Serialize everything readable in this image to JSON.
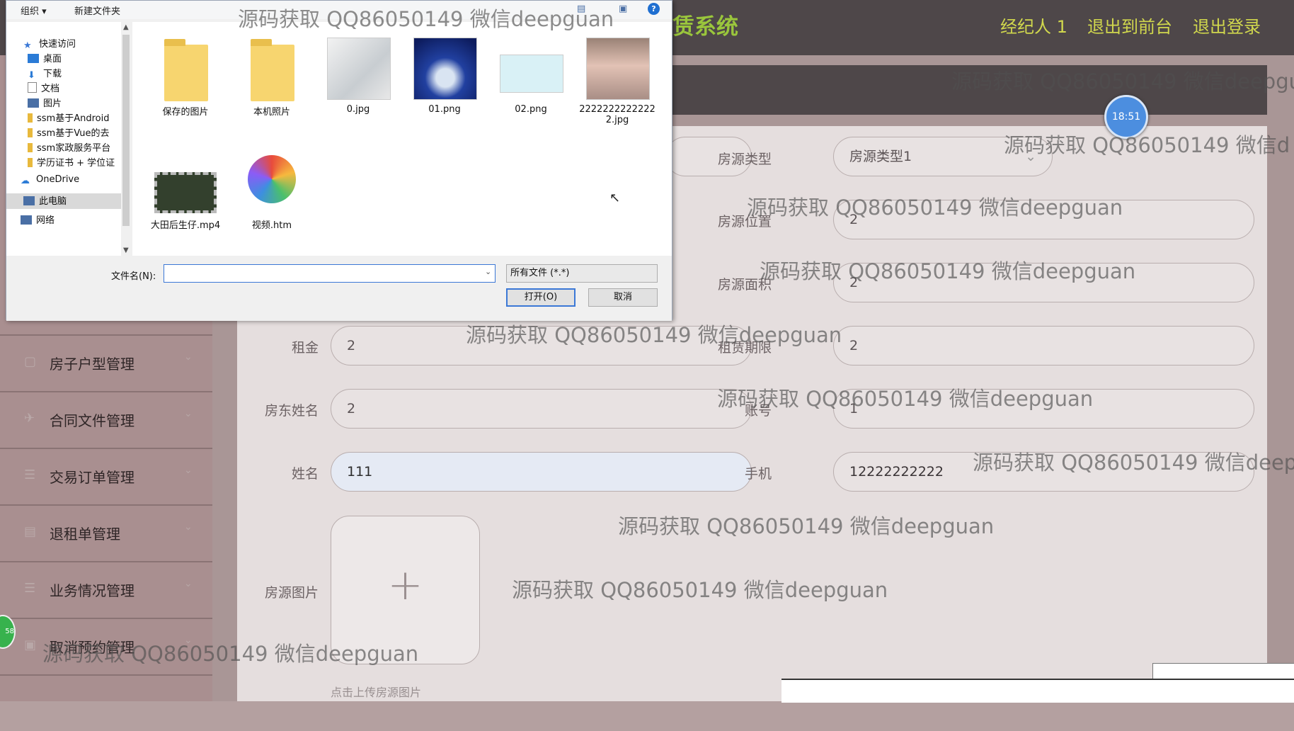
{
  "header": {
    "title": "赁系统",
    "links": [
      "经纪人 1",
      "退出到前台",
      "退出登录"
    ]
  },
  "sidebar": {
    "items": [
      {
        "label": "房子户型管理",
        "icon": "square-icon"
      },
      {
        "label": "合同文件管理",
        "icon": "send-icon"
      },
      {
        "label": "交易订单管理",
        "icon": "list-icon"
      },
      {
        "label": "退租单管理",
        "icon": "doc-icon"
      },
      {
        "label": "业务情况管理",
        "icon": "list-icon"
      },
      {
        "label": "取消预约管理",
        "icon": "calendar-icon"
      }
    ]
  },
  "clock": "18:51",
  "green_badge": "58",
  "form": {
    "house_type_label": "房源类型",
    "house_type_value": "房源类型1",
    "location_label": "房源位置",
    "location_value": "2",
    "area_label": "房源面积",
    "area_value": "2",
    "rent_label": "租金",
    "rent_value": "2",
    "lease_label": "租赁期限",
    "lease_value": "2",
    "landlord_label": "房东姓名",
    "landlord_value": "2",
    "account_label": "账号",
    "account_value": "1",
    "name_label": "姓名",
    "name_value": "111",
    "phone_label": "手机",
    "phone_value": "12222222222",
    "image_label": "房源图片",
    "upload_hint": "点击上传房源图片"
  },
  "dialog": {
    "toolbar": {
      "organize": "组织 ▾",
      "new_folder": "新建文件夹"
    },
    "nav": [
      {
        "label": "快速访问",
        "color": "#3a78d6"
      },
      {
        "label": "桌面",
        "color": "#2b7bd6"
      },
      {
        "label": "下载",
        "color": "#2b7bd6"
      },
      {
        "label": "文档",
        "color": "#8a8a8a"
      },
      {
        "label": "图片",
        "color": "#4a6fa5"
      },
      {
        "label": "ssm基于Android",
        "color": "#e8b93d"
      },
      {
        "label": "ssm基于Vue的去",
        "color": "#e8b93d"
      },
      {
        "label": "ssm家政服务平台",
        "color": "#e8b93d"
      },
      {
        "label": "学历证书 + 学位证",
        "color": "#e8b93d"
      },
      {
        "label": "OneDrive",
        "color": "#2b7bd6"
      },
      {
        "label": "此电脑",
        "color": "#4a6fa5"
      },
      {
        "label": "网络",
        "color": "#4a6fa5"
      }
    ],
    "files": [
      {
        "name": "保存的图片",
        "kind": "folder"
      },
      {
        "name": "本机照片",
        "kind": "folder"
      },
      {
        "name": "0.jpg",
        "kind": "image",
        "color": "#cfd3d6"
      },
      {
        "name": "01.png",
        "kind": "image",
        "color": "#1f3a8a"
      },
      {
        "name": "02.png",
        "kind": "image",
        "color": "#cfeef5"
      },
      {
        "name": "22222222222222.jpg",
        "kind": "image",
        "color": "#c9a99c"
      },
      {
        "name": "大田后生仔.mp4",
        "kind": "video",
        "color": "#2f3a2a"
      },
      {
        "name": "视频.htm",
        "kind": "html",
        "color": "#ffffff"
      }
    ],
    "filename_label": "文件名(N):",
    "filename_value": "",
    "filetype": "所有文件 (*.*)",
    "open_btn": "打开(O)",
    "cancel_btn": "取消"
  },
  "watermarks": [
    "源码获取 QQ86050149 微信deepguan",
    "源码获取 QQ86050149 微信deepgu",
    "源码获取 QQ86050149 微信d",
    "源码获取 QQ86050149 微信deepguan",
    "源码获取 QQ86050149 微信deepguan",
    "源码获取 QQ86050149 微信deepguan",
    "源码获取 QQ86050149 微信deepguan",
    "源码获取 QQ86050149 微信deep",
    "源码获取 QQ86050149 微信deepguan",
    "源码获取 QQ86050149 微信deepguan",
    "源码获取 QQ86050149 微信deepguan"
  ]
}
